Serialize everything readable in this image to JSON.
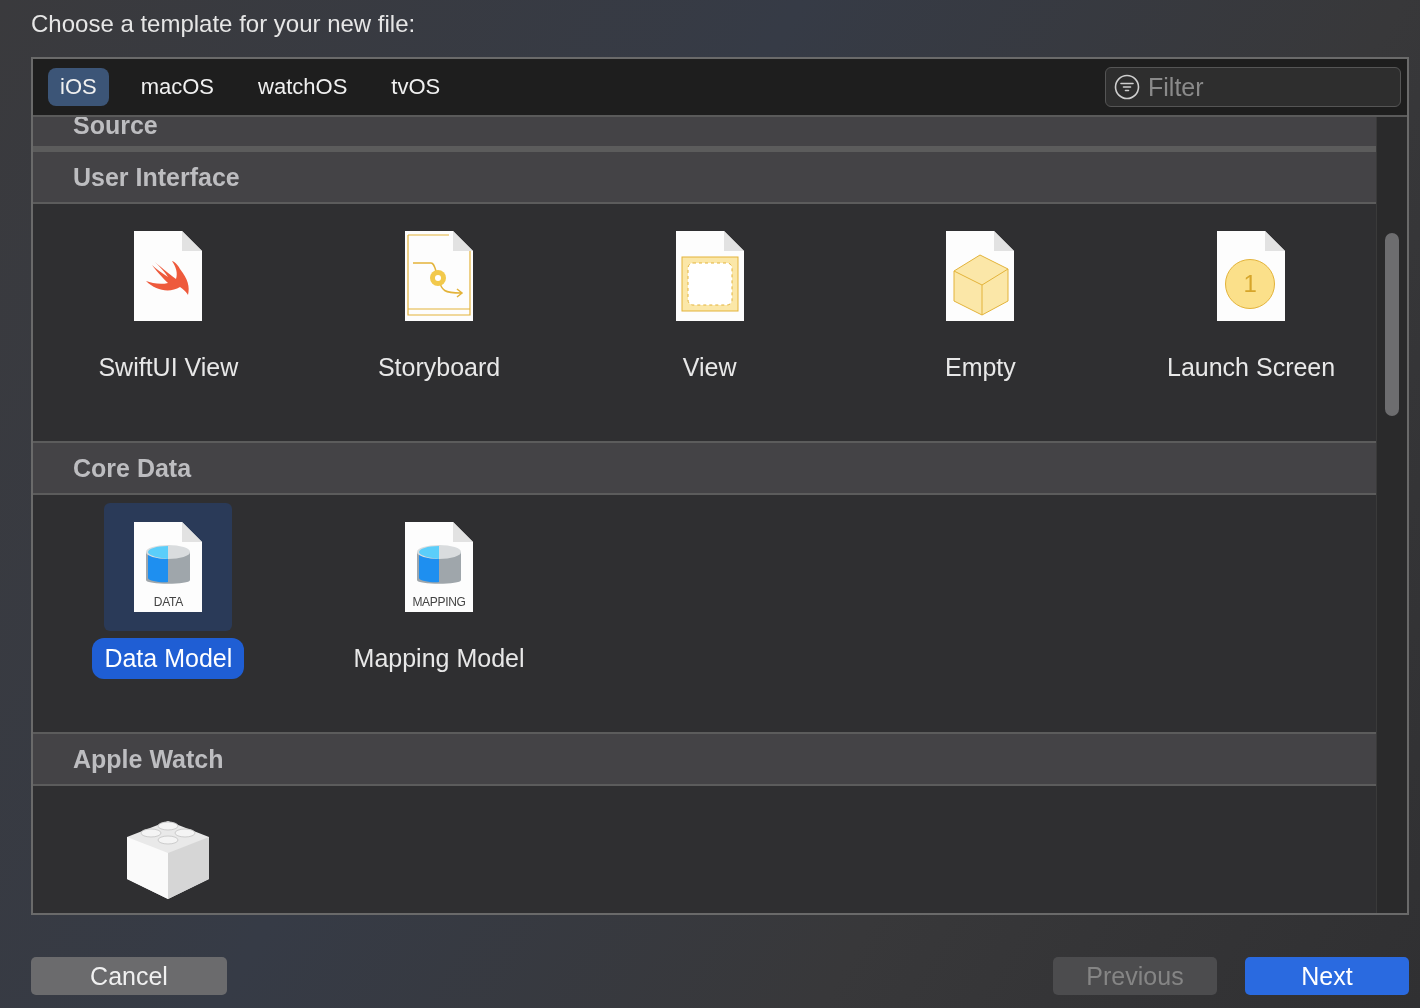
{
  "title": "Choose a template for your new file:",
  "tabs": [
    {
      "label": "iOS",
      "selected": true
    },
    {
      "label": "macOS",
      "selected": false
    },
    {
      "label": "watchOS",
      "selected": false
    },
    {
      "label": "tvOS",
      "selected": false
    }
  ],
  "filter": {
    "placeholder": "Filter"
  },
  "sections": [
    {
      "title": "Source"
    },
    {
      "title": "User Interface",
      "items": [
        {
          "kind": "swift",
          "label": "SwiftUI View",
          "selected": false
        },
        {
          "kind": "storyboard",
          "label": "Storyboard",
          "selected": false
        },
        {
          "kind": "view",
          "label": "View",
          "selected": false
        },
        {
          "kind": "empty",
          "label": "Empty",
          "selected": false
        },
        {
          "kind": "launch",
          "label": "Launch Screen",
          "badge": "1",
          "selected": false
        }
      ]
    },
    {
      "title": "Core Data",
      "items": [
        {
          "kind": "data",
          "label": "Data Model",
          "badge": "DATA",
          "selected": true
        },
        {
          "kind": "data",
          "label": "Mapping Model",
          "badge": "MAPPING",
          "selected": false
        }
      ]
    },
    {
      "title": "Apple Watch",
      "items": [
        {
          "kind": "brick",
          "selected": false
        }
      ]
    }
  ],
  "buttons": [
    {
      "label": "Cancel",
      "kind": "normal",
      "disabled": false
    },
    {
      "label": "Previous",
      "kind": "normal",
      "disabled": true
    },
    {
      "label": "Next",
      "kind": "default",
      "disabled": false
    }
  ]
}
